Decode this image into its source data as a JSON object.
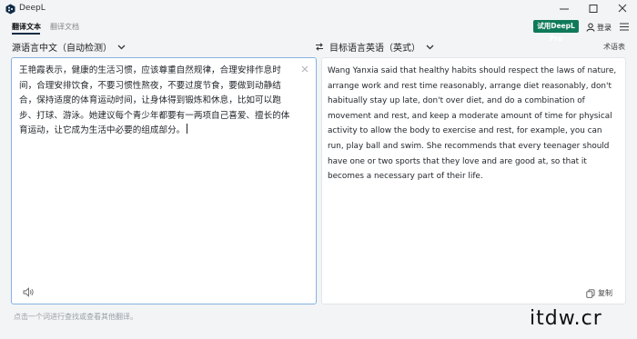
{
  "window": {
    "title": "DeepL"
  },
  "tabs": [
    {
      "label": "翻译文本",
      "active": true
    },
    {
      "label": "翻译文档",
      "active": false
    }
  ],
  "header": {
    "pro_button": "试用DeepL Pro",
    "login": "登录"
  },
  "source": {
    "language": "源语言中文（自动检测）",
    "text": "王艳霞表示，健康的生活习惯，应该尊重自然规律，合理安排作息时间，合理安排饮食，不要习惯性熬夜，不要过度节食，要做到动静结合，保持适度的体育运动时间，让身体得到锻炼和休息，比如可以跑步、打球、游泳。她建议每个青少年都要有一两项自己喜爱、擅长的体育运动，让它成为生活中必要的组成部分。"
  },
  "target": {
    "language": "目标语言英语（英式）",
    "glossary": "术语表",
    "text": "Wang Yanxia said that healthy habits should respect the laws of nature, arrange work and rest time reasonably, arrange diet reasonably, don't habitually stay up late, don't over diet, and do a combination of movement and rest, and keep a moderate amount of time for physical activity to allow the body to exercise and rest, for example, you can run, play ball and swim. She recommends that every teenager should have one or two sports that they love and are good at, so that it becomes a necessary part of their life.",
    "copy_label": "复制"
  },
  "footer": {
    "hint": "点击一个词进行查找或查看其他翻译。"
  },
  "watermark": "itdw.cr",
  "colors": {
    "accent": "#0f2b46",
    "pro_green": "#0f7a5a",
    "focus_border": "#84b3e3"
  }
}
